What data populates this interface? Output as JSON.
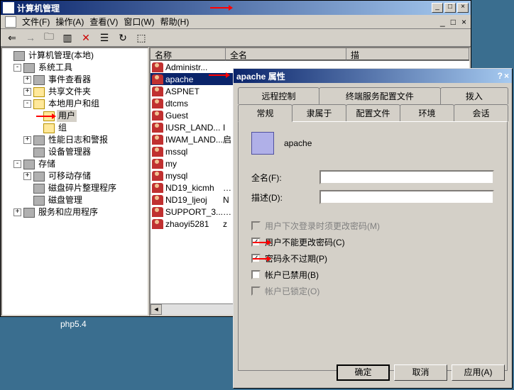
{
  "mmc": {
    "title": "计算机管理",
    "menu": {
      "file": "文件(F)",
      "action": "操作(A)",
      "view": "查看(V)",
      "window": "窗口(W)",
      "help": "帮助(H)"
    },
    "sysbtns": {
      "min": "_",
      "max": "□",
      "close": "×"
    },
    "tree": {
      "root": "计算机管理(本地)",
      "systools": "系统工具",
      "eventviewer": "事件查看器",
      "sharedfolders": "共享文件夹",
      "localusers": "本地用户和组",
      "users": "用户",
      "groups": "组",
      "perflogs": "性能日志和警报",
      "devmgr": "设备管理器",
      "storage": "存储",
      "removable": "可移动存储",
      "defrag": "磁盘碎片整理程序",
      "diskmgmt": "磁盘管理",
      "services": "服务和应用程序"
    },
    "list": {
      "col_name": "名称",
      "col_fullname": "全名",
      "col_desc": "描",
      "rows": [
        {
          "name": "Administr..."
        },
        {
          "name": "apache"
        },
        {
          "name": "ASPNET"
        },
        {
          "name": "dtcms"
        },
        {
          "name": "Guest"
        },
        {
          "name": "IUSR_LAND...",
          "full": "I"
        },
        {
          "name": "IWAM_LAND...",
          "full": "启"
        },
        {
          "name": "mssql"
        },
        {
          "name": "my"
        },
        {
          "name": "mysql"
        },
        {
          "name": "ND19_kicmh",
          "full": "…"
        },
        {
          "name": "ND19_ljeoj",
          "full": "N"
        },
        {
          "name": "SUPPORT_3...",
          "full": "…"
        },
        {
          "name": "zhaoyi5281",
          "full": "z"
        }
      ]
    }
  },
  "taskbar": {
    "item": "php5.4"
  },
  "dialog": {
    "title": "apache 属性",
    "help_btn": "?",
    "close_btn": "×",
    "tabs_row2": {
      "remote": "远程控制",
      "tsprofile": "终端服务配置文件",
      "dialin": "拨入"
    },
    "tabs_row1": {
      "general": "常规",
      "memberof": "隶属于",
      "profile": "配置文件",
      "env": "环境",
      "sessions": "会话"
    },
    "username": "apache",
    "fullname_lbl": "全名(F):",
    "desc_lbl": "描述(D):",
    "fullname_val": "",
    "desc_val": "",
    "chk_mustchange": "用户下次登录时须更改密码(M)",
    "chk_cannotchange": "用户不能更改密码(C)",
    "chk_neverexpire": "密码永不过期(P)",
    "chk_disabled": "帐户已禁用(B)",
    "chk_locked": "帐户已锁定(O)",
    "btn_ok": "确定",
    "btn_cancel": "取消",
    "btn_apply": "应用(A)"
  }
}
